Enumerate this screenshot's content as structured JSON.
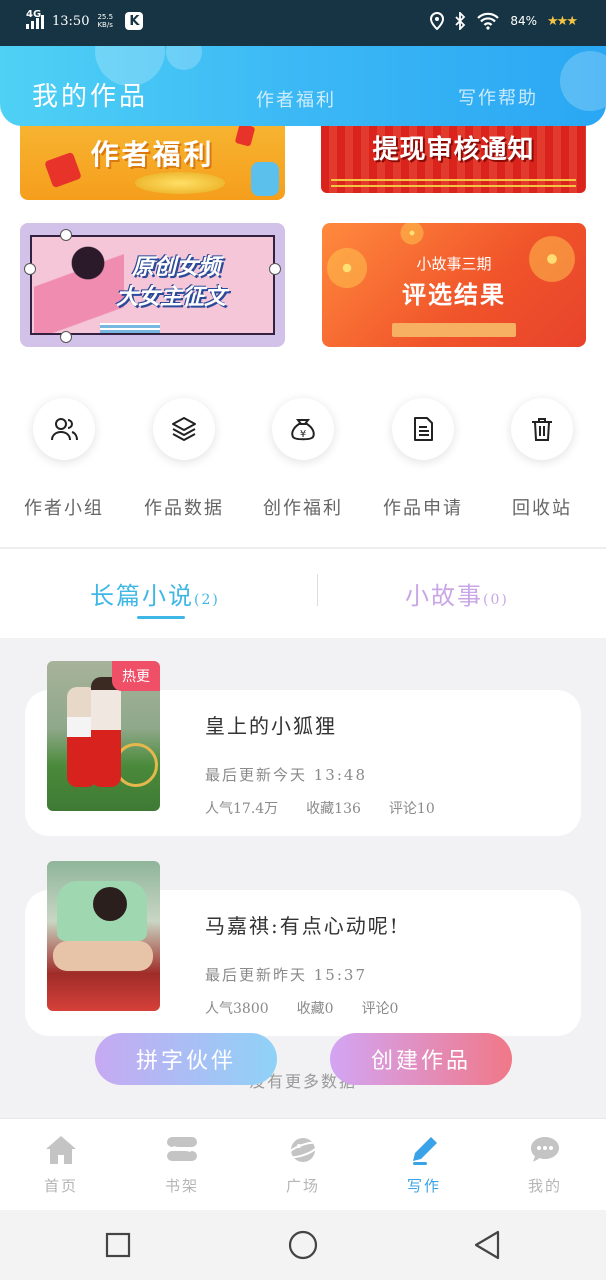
{
  "status_bar": {
    "network": "4G",
    "time": "13:50",
    "net_speed": "25.5",
    "net_speed_unit": "KB/s",
    "app_badge": "K",
    "battery": "84%"
  },
  "header": {
    "tabs": [
      "我的作品",
      "作者福利",
      "写作帮助"
    ],
    "colors": {
      "start": "#4fd1f5",
      "end": "#2aa7f3"
    }
  },
  "banners": {
    "welfare": "作者福利",
    "withdraw_notice": "提现审核通知",
    "contest_line1": "原创女频",
    "contest_line2": "大女主征文",
    "story_line1": "小故事三期",
    "story_line2": "评选结果"
  },
  "quick_actions": [
    {
      "label": "作者小组",
      "icon": "users-icon"
    },
    {
      "label": "作品数据",
      "icon": "layers-icon"
    },
    {
      "label": "创作福利",
      "icon": "money-bag-icon"
    },
    {
      "label": "作品申请",
      "icon": "document-icon"
    },
    {
      "label": "回收站",
      "icon": "trash-icon"
    }
  ],
  "tabs": {
    "novel": {
      "label": "长篇小说",
      "count": "(2)"
    },
    "story": {
      "label": "小故事",
      "count": "(0)"
    }
  },
  "works": [
    {
      "title": "皇上的小狐狸",
      "updated": "最后更新今天 13:48",
      "popularity": "人气17.4万",
      "favorites": "收藏136",
      "comments": "评论10",
      "tag": "热更"
    },
    {
      "title": "马嘉祺:有点心动呢!",
      "updated": "最后更新昨天 15:37",
      "popularity": "人气3800",
      "favorites": "收藏0",
      "comments": "评论0"
    }
  ],
  "no_more": "没有更多数据",
  "actions": {
    "partner": "拼字伙伴",
    "create": "创建作品"
  },
  "bottom_nav": [
    {
      "label": "首页",
      "icon": "home-icon"
    },
    {
      "label": "书架",
      "icon": "bookshelf-icon"
    },
    {
      "label": "广场",
      "icon": "planet-icon"
    },
    {
      "label": "写作",
      "icon": "pen-icon",
      "active": true
    },
    {
      "label": "我的",
      "icon": "chat-bubble-icon"
    }
  ]
}
